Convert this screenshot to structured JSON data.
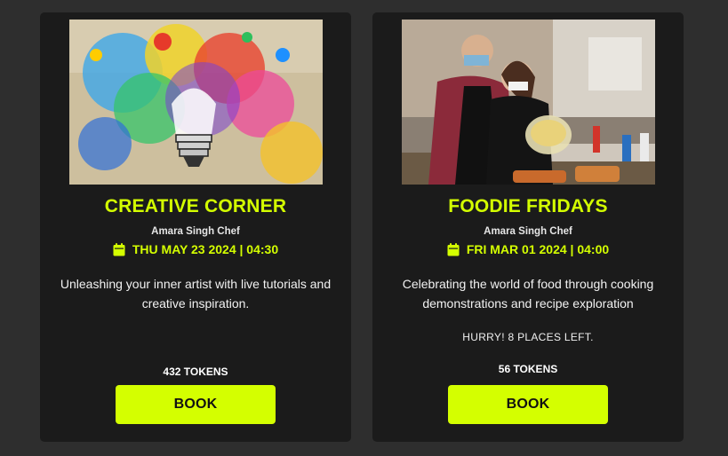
{
  "events": [
    {
      "title": "CREATIVE CORNER",
      "host": "Amara Singh Chef",
      "datetime": "THU MAY 23 2024 | 04:30",
      "description": "Unleashing your inner artist with live tutorials and creative inspiration.",
      "notice": "",
      "tokens": "432 TOKENS",
      "button_label": "BOOK",
      "image_icon": "colorful-lightbulb-image"
    },
    {
      "title": "FOODIE FRIDAYS",
      "host": "Amara Singh Chef",
      "datetime": "FRI MAR 01 2024 | 04:00",
      "description": "Celebrating the world of food through cooking demonstrations and recipe exploration",
      "notice": "HURRY! 8 PLACES LEFT.",
      "tokens": "56 TOKENS",
      "button_label": "BOOK",
      "image_icon": "cooking-class-photo"
    }
  ],
  "colors": {
    "page_background": "#2e2e2e",
    "card_background": "#1b1b1b",
    "accent": "#d4ff00",
    "text": "#f2f2f2"
  }
}
